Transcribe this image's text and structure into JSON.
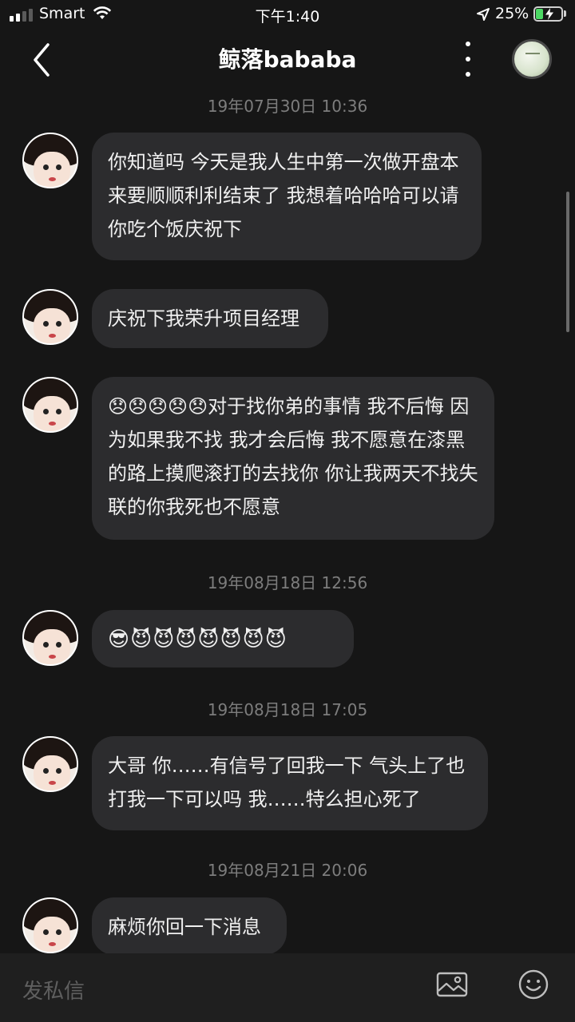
{
  "status_bar": {
    "carrier": "Smart",
    "time": "下午1:40",
    "battery": "25%"
  },
  "header": {
    "title": "鲸落bababa"
  },
  "messages": [
    {
      "timestamp": "19年07月30日 10:36"
    },
    {
      "text": "你知道吗 今天是我人生中第一次做开盘本来要顺顺利利结束了 我想着哈哈哈可以请你吃个饭庆祝下"
    },
    {
      "text": "庆祝下我荣升项目经理"
    },
    {
      "text": "😞😞😞😞😞对于找你弟的事情 我不后悔 因为如果我不找 我才会后悔 我不愿意在漆黑的路上摸爬滚打的去找你 你让我两天不找失联的你我死也不愿意"
    },
    {
      "timestamp": "19年08月18日 12:56"
    },
    {
      "text": "😎😈😈😈😈😈😈😈"
    },
    {
      "timestamp": "19年08月18日 17:05"
    },
    {
      "text": "大哥 你……有信号了回我一下 气头上了也打我一下可以吗 我……特么担心死了"
    },
    {
      "timestamp": "19年08月21日 20:06"
    },
    {
      "text": "麻烦你回一下消息"
    }
  ],
  "composer": {
    "placeholder": "发私信"
  }
}
